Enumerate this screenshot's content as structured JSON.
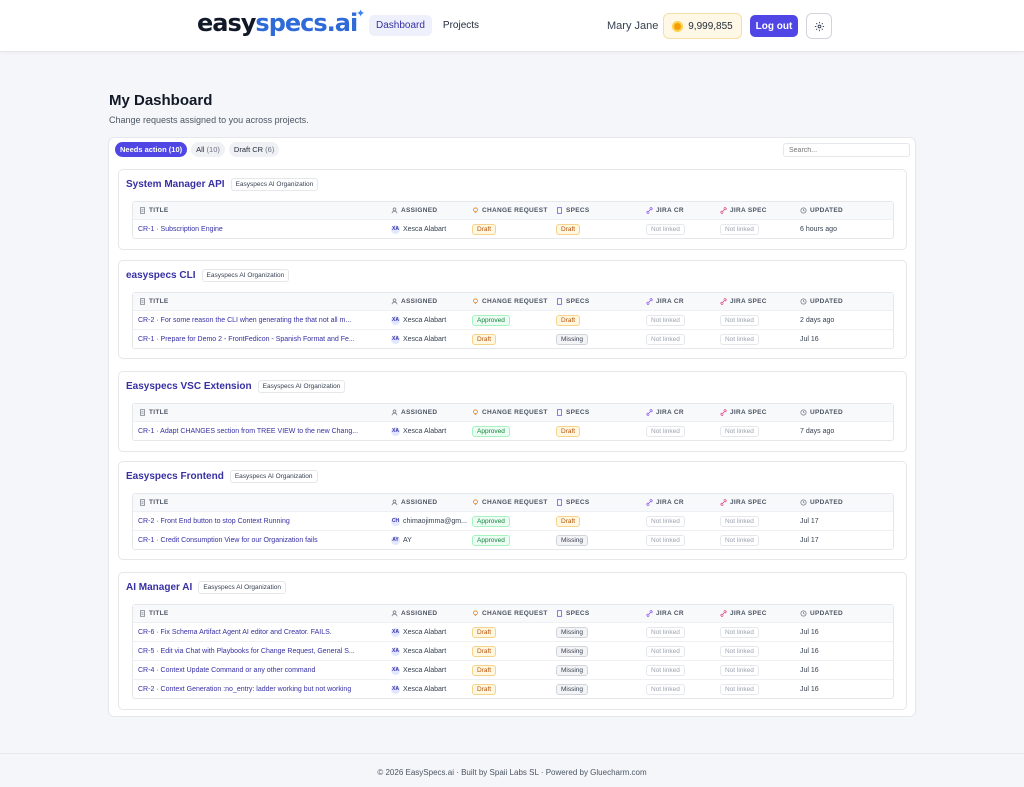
{
  "header": {
    "logo_part1": "easy",
    "logo_part2": "specs.ai",
    "nav": [
      {
        "label": "Dashboard",
        "active": true
      },
      {
        "label": "Projects",
        "active": false
      }
    ],
    "user_name": "Mary Jane",
    "credits": "9,999,855",
    "logout_label": "Log out"
  },
  "page": {
    "title": "My Dashboard",
    "subtitle": "Change requests assigned to you across projects."
  },
  "filters": [
    {
      "label": "Needs action",
      "count": "(10)",
      "active": true
    },
    {
      "label": "All",
      "count": "(10)",
      "active": false
    },
    {
      "label": "Draft CR",
      "count": "(6)",
      "active": false
    }
  ],
  "search_placeholder": "Search...",
  "columns": {
    "title": "TITLE",
    "assigned": "ASSIGNED",
    "change_request": "CHANGE REQUEST",
    "specs": "SPECS",
    "jira_cr": "JIRA CR",
    "jira_spec": "JIRA SPEC",
    "updated": "UPDATED"
  },
  "projects": [
    {
      "name": "System Manager API",
      "org": "Easyspecs AI Organization",
      "rows": [
        {
          "title": "CR-1 · Subscription Engine",
          "initials": "XA",
          "assigned": "Xesca Alabart",
          "cr": "Draft",
          "specs": "Draft",
          "jira_cr": "Not linked",
          "jira_spec": "Not linked",
          "updated": "6 hours ago"
        }
      ]
    },
    {
      "name": "easyspecs CLI",
      "org": "Easyspecs AI Organization",
      "rows": [
        {
          "title": "CR-2 · For some reason the CLI when generating the that not all m...",
          "initials": "XA",
          "assigned": "Xesca Alabart",
          "cr": "Approved",
          "specs": "Draft",
          "jira_cr": "Not linked",
          "jira_spec": "Not linked",
          "updated": "2 days ago"
        },
        {
          "title": "CR-1 · Prepare for Demo 2 - FrontFedicon - Spanish Format and Fe...",
          "initials": "XA",
          "assigned": "Xesca Alabart",
          "cr": "Draft",
          "specs": "Missing",
          "jira_cr": "Not linked",
          "jira_spec": "Not linked",
          "updated": "Jul 16"
        }
      ]
    },
    {
      "name": "Easyspecs VSC Extension",
      "org": "Easyspecs AI Organization",
      "rows": [
        {
          "title": "CR-1 · Adapt CHANGES section from TREE VIEW to the new Chang...",
          "initials": "XA",
          "assigned": "Xesca Alabart",
          "cr": "Approved",
          "specs": "Draft",
          "jira_cr": "Not linked",
          "jira_spec": "Not linked",
          "updated": "7 days ago"
        }
      ]
    },
    {
      "name": "Easyspecs Frontend",
      "org": "Easyspecs AI Organization",
      "rows": [
        {
          "title": "CR-2 · Front End button to stop Context Running",
          "initials": "CH",
          "assigned": "chimaojimma@gm...",
          "cr": "Approved",
          "specs": "Draft",
          "jira_cr": "Not linked",
          "jira_spec": "Not linked",
          "updated": "Jul 17"
        },
        {
          "title": "CR-1 · Credit Consumption View for our Organization fails",
          "initials": "AY",
          "assigned": "AY",
          "cr": "Approved",
          "specs": "Missing",
          "jira_cr": "Not linked",
          "jira_spec": "Not linked",
          "updated": "Jul 17"
        }
      ]
    },
    {
      "name": "AI Manager AI",
      "org": "Easyspecs AI Organization",
      "rows": [
        {
          "title": "CR-6 · Fix Schema Artifact Agent AI editor and Creator. FAILS.",
          "initials": "XA",
          "assigned": "Xesca Alabart",
          "cr": "Draft",
          "specs": "Missing",
          "jira_cr": "Not linked",
          "jira_spec": "Not linked",
          "updated": "Jul 16"
        },
        {
          "title": "CR-5 · Edit via Chat with Playbooks for Change Request, General S...",
          "initials": "XA",
          "assigned": "Xesca Alabart",
          "cr": "Draft",
          "specs": "Missing",
          "jira_cr": "Not linked",
          "jira_spec": "Not linked",
          "updated": "Jul 16"
        },
        {
          "title": "CR-4 · Context Update Command or any other command",
          "initials": "XA",
          "assigned": "Xesca Alabart",
          "cr": "Draft",
          "specs": "Missing",
          "jira_cr": "Not linked",
          "jira_spec": "Not linked",
          "updated": "Jul 16"
        },
        {
          "title": "CR-2 · Context Generation :no_entry: ladder working but not working",
          "initials": "XA",
          "assigned": "Xesca Alabart",
          "cr": "Draft",
          "specs": "Missing",
          "jira_cr": "Not linked",
          "jira_spec": "Not linked",
          "updated": "Jul 16"
        }
      ]
    }
  ],
  "footer": "© 2026 EasySpecs.ai · Built by Spaii Labs SL · Powered by Gluecharm.com",
  "colors": {
    "accent": "#4f46e5",
    "link": "#3730a3",
    "draft": "#b45309",
    "approved": "#15803d"
  }
}
